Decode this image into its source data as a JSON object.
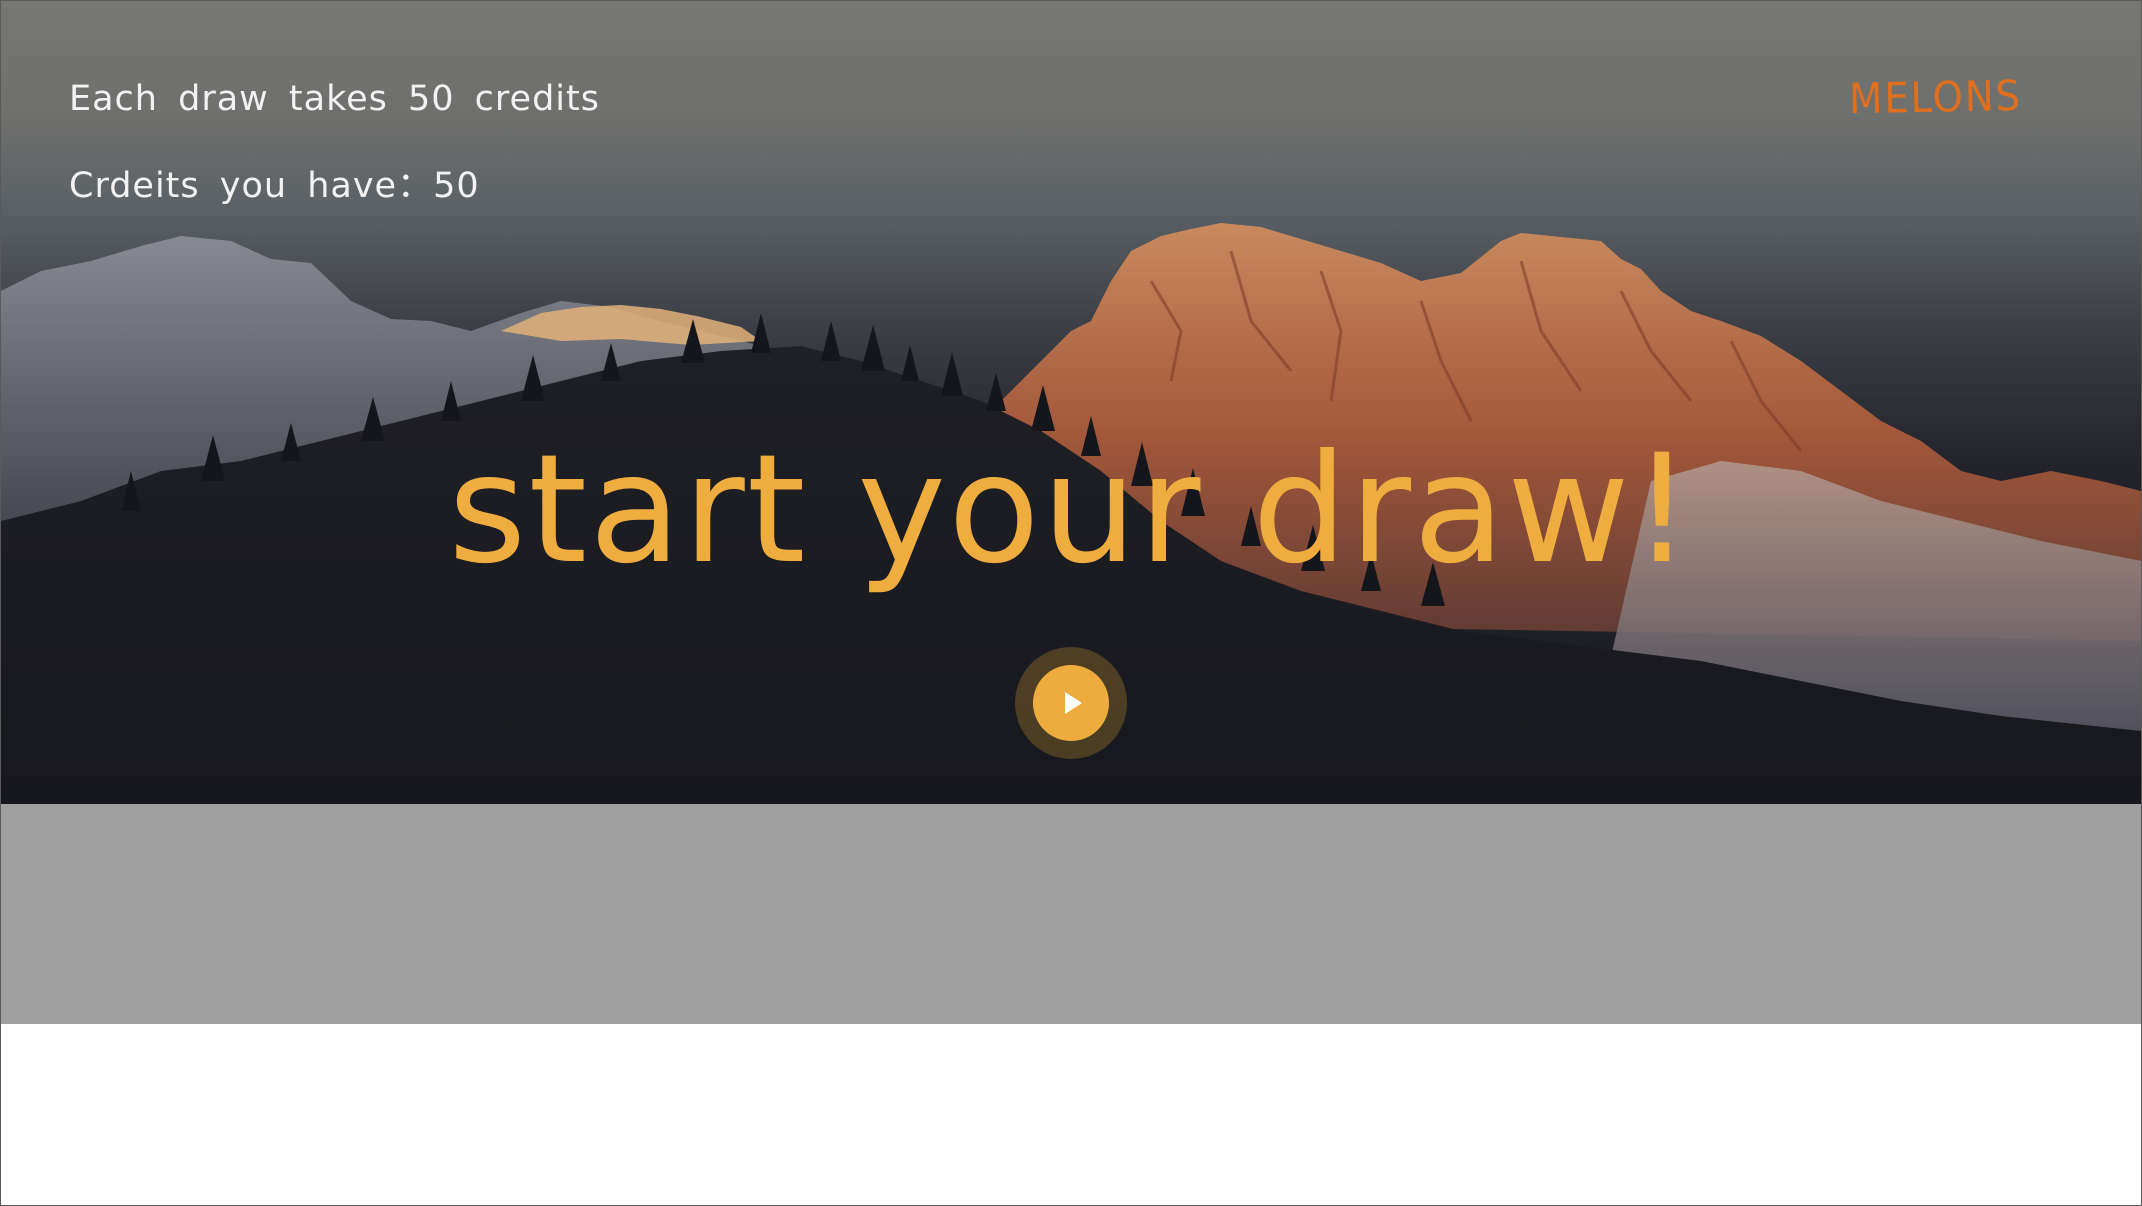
{
  "credits": {
    "cost_label": "Each draw takes 50 credits",
    "balance_label": "Crdeits you have：50"
  },
  "brand": {
    "name": "MELONS",
    "color": "#e0701e"
  },
  "hero": {
    "headline": "start your draw!",
    "accent_color": "#f0ad3f",
    "play_icon": "play-icon"
  }
}
